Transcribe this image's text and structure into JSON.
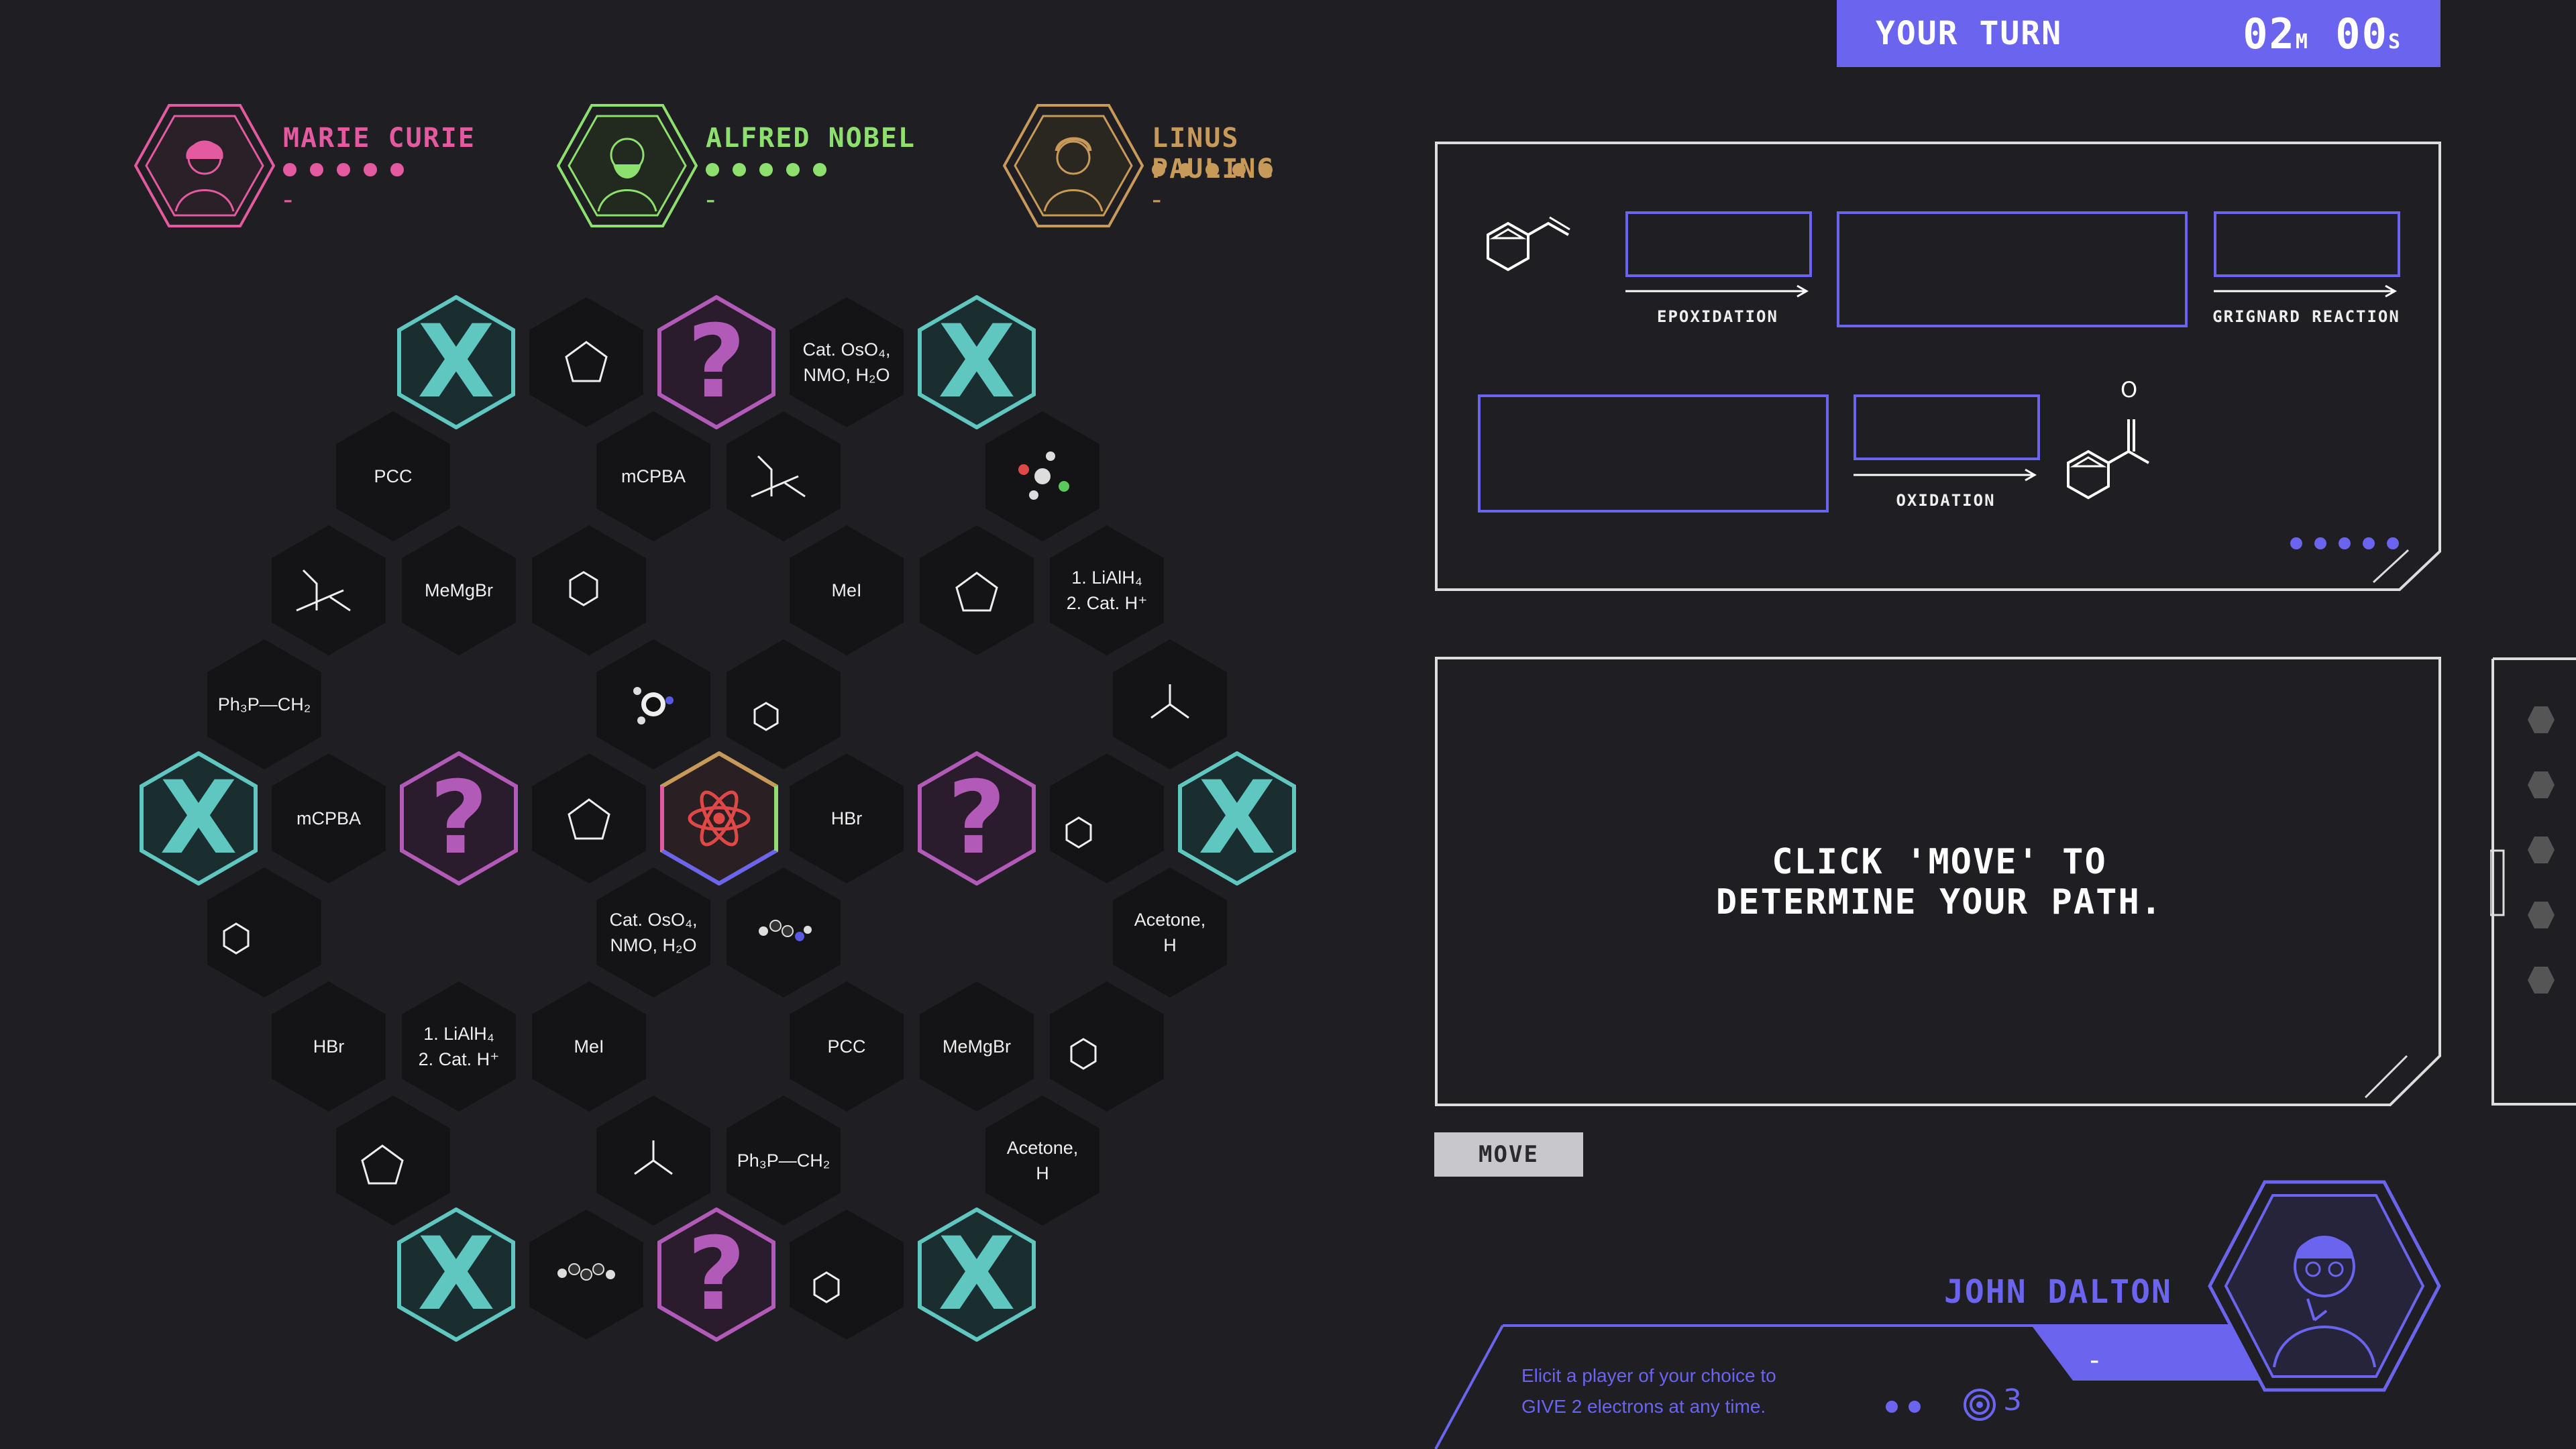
{
  "turn": {
    "label": "YOUR TURN",
    "min": "02",
    "min_unit": "M",
    "sec": "00",
    "sec_unit": "S"
  },
  "colors": {
    "accent": "#6a64ee",
    "curie": "#e45aa0",
    "nobel": "#8ee06e",
    "pauling": "#c89a5a",
    "teal": "#5fc6c0",
    "question": "#b25ab8",
    "atom": "#e04848"
  },
  "players": [
    {
      "name": "MARIE CURIE",
      "score": "-",
      "color": "#e45aa0"
    },
    {
      "name": "ALFRED NOBEL",
      "score": "-",
      "color": "#8ee06e"
    },
    {
      "name": "LINUS PAULING",
      "score": "-",
      "color": "#c89a5a"
    }
  ],
  "reaction_panel": {
    "step1": "EPOXIDATION",
    "step2": "GRIGNARD REACTION",
    "step3": "OXIDATION",
    "product_atom": "O"
  },
  "prompt": {
    "line1": "CLICK 'MOVE' TO",
    "line2": "DETERMINE YOUR PATH."
  },
  "move_label": "MOVE",
  "current_player": {
    "name": "JOHN DALTON",
    "score": "-"
  },
  "card": {
    "line1": "Elicit a player of your choice to",
    "line2": "GIVE 2 electrons at any time.",
    "electrons": "3"
  },
  "board": {
    "tiles": [
      {
        "text": "PCC"
      },
      {
        "text": "mCPBA"
      },
      {
        "text": "MeMgBr"
      },
      {
        "text": "MeI"
      },
      {
        "text": "1. LiAlH₄\n2. Cat. H⁺"
      },
      {
        "text": "Ph₃P—CH₂"
      },
      {
        "text": "mCPBA"
      },
      {
        "text": "HBr"
      },
      {
        "text": "Cat. OsO₄,\nNMO, H₂O"
      },
      {
        "text": "Acetone,\nH"
      },
      {
        "text": "HBr"
      },
      {
        "text": "1. LiAlH₄\n2. Cat. H⁺"
      },
      {
        "text": "MeI"
      },
      {
        "text": "PCC"
      },
      {
        "text": "MeMgBr"
      },
      {
        "text": "Ph₃P—CH₂"
      },
      {
        "text": "Acetone,\nH"
      },
      {
        "text": "Cat. OsO₄,\nNMO, H₂O"
      }
    ],
    "special": {
      "blocked": "X",
      "mystery": "?"
    }
  }
}
